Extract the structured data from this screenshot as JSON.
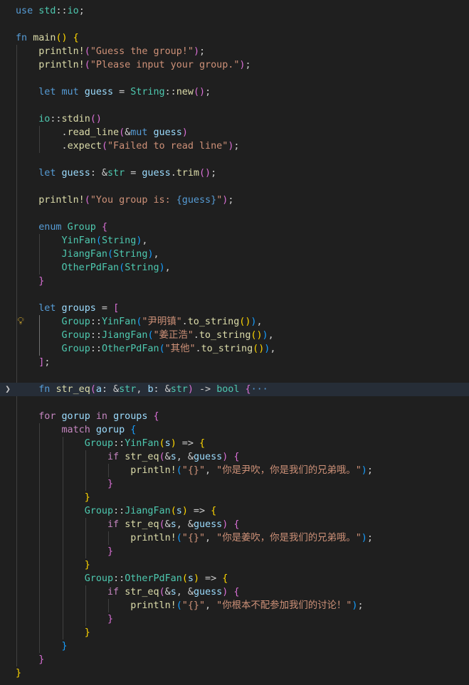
{
  "editor": {
    "theme_colors": {
      "background": "#1f1f1f",
      "keyword": "#569cd6",
      "control": "#c586c0",
      "function": "#dcdcaa",
      "variable": "#9cdcfe",
      "type": "#4ec9b0",
      "string": "#ce9178",
      "bracket_1": "#ffd700",
      "bracket_2": "#da70d6",
      "bracket_3": "#179fff"
    },
    "icons": {
      "fold_chevron": "chevron-right-icon",
      "lightbulb": "lightbulb-icon"
    },
    "lines": [
      [
        [
          "use ",
          "kw"
        ],
        [
          "std",
          "type"
        ],
        [
          "::",
          "punc"
        ],
        [
          "io",
          "type"
        ],
        [
          ";",
          "punc"
        ]
      ],
      [],
      [
        [
          "fn ",
          "kw"
        ],
        [
          "main",
          "fn"
        ],
        [
          "()",
          "b1"
        ],
        [
          " ",
          "punc"
        ],
        [
          "{",
          "b1"
        ]
      ],
      [
        [
          "    println!",
          "fn"
        ],
        [
          "(",
          "b2"
        ],
        [
          "\"Guess the group!\"",
          "str"
        ],
        [
          ")",
          "b2"
        ],
        [
          ";",
          "punc"
        ]
      ],
      [
        [
          "    println!",
          "fn"
        ],
        [
          "(",
          "b2"
        ],
        [
          "\"Please input your group.\"",
          "str"
        ],
        [
          ")",
          "b2"
        ],
        [
          ";",
          "punc"
        ]
      ],
      [],
      [
        [
          "    let ",
          "kw"
        ],
        [
          "mut ",
          "kw"
        ],
        [
          "guess",
          "var"
        ],
        [
          " = ",
          "punc"
        ],
        [
          "String",
          "type"
        ],
        [
          "::",
          "punc"
        ],
        [
          "new",
          "fn"
        ],
        [
          "()",
          "b2"
        ],
        [
          ";",
          "punc"
        ]
      ],
      [],
      [
        [
          "    io",
          "type"
        ],
        [
          "::",
          "punc"
        ],
        [
          "stdin",
          "fn"
        ],
        [
          "()",
          "b2"
        ]
      ],
      [
        [
          "        .",
          "punc"
        ],
        [
          "read_line",
          "fn"
        ],
        [
          "(",
          "b2"
        ],
        [
          "&",
          "punc"
        ],
        [
          "mut ",
          "kw"
        ],
        [
          "guess",
          "var"
        ],
        [
          ")",
          "b2"
        ]
      ],
      [
        [
          "        .",
          "punc"
        ],
        [
          "expect",
          "fn"
        ],
        [
          "(",
          "b2"
        ],
        [
          "\"Failed to read line\"",
          "str"
        ],
        [
          ")",
          "b2"
        ],
        [
          ";",
          "punc"
        ]
      ],
      [],
      [
        [
          "    let ",
          "kw"
        ],
        [
          "guess",
          "var"
        ],
        [
          ": &",
          "punc"
        ],
        [
          "str",
          "type"
        ],
        [
          " = ",
          "punc"
        ],
        [
          "guess",
          "var"
        ],
        [
          ".",
          "punc"
        ],
        [
          "trim",
          "fn"
        ],
        [
          "()",
          "b2"
        ],
        [
          ";",
          "punc"
        ]
      ],
      [],
      [
        [
          "    println!",
          "fn"
        ],
        [
          "(",
          "b2"
        ],
        [
          "\"You group is: ",
          "str"
        ],
        [
          "{guess}",
          "esc"
        ],
        [
          "\"",
          "str"
        ],
        [
          ")",
          "b2"
        ],
        [
          ";",
          "punc"
        ]
      ],
      [],
      [
        [
          "    enum ",
          "kw"
        ],
        [
          "Group",
          "type"
        ],
        [
          " ",
          "punc"
        ],
        [
          "{",
          "b2"
        ]
      ],
      [
        [
          "        YinFan",
          "type"
        ],
        [
          "(",
          "b3"
        ],
        [
          "String",
          "type"
        ],
        [
          ")",
          "b3"
        ],
        [
          ",",
          "punc"
        ]
      ],
      [
        [
          "        JiangFan",
          "type"
        ],
        [
          "(",
          "b3"
        ],
        [
          "String",
          "type"
        ],
        [
          ")",
          "b3"
        ],
        [
          ",",
          "punc"
        ]
      ],
      [
        [
          "        OtherPdFan",
          "type"
        ],
        [
          "(",
          "b3"
        ],
        [
          "String",
          "type"
        ],
        [
          ")",
          "b3"
        ],
        [
          ",",
          "punc"
        ]
      ],
      [
        [
          "    }",
          "b2"
        ]
      ],
      [],
      [
        [
          "    let ",
          "kw"
        ],
        [
          "groups",
          "var"
        ],
        [
          " = ",
          "punc"
        ],
        [
          "[",
          "b2"
        ]
      ],
      [
        [
          "        Group",
          "type"
        ],
        [
          "::",
          "punc"
        ],
        [
          "YinFan",
          "type"
        ],
        [
          "(",
          "b3"
        ],
        [
          "\"尹明镇\"",
          "str"
        ],
        [
          ".",
          "punc"
        ],
        [
          "to_string",
          "fn"
        ],
        [
          "()",
          "b1"
        ],
        [
          ")",
          "b3"
        ],
        [
          ",",
          "punc"
        ]
      ],
      [
        [
          "        Group",
          "type"
        ],
        [
          "::",
          "punc"
        ],
        [
          "JiangFan",
          "type"
        ],
        [
          "(",
          "b3"
        ],
        [
          "\"姜正浩\"",
          "str"
        ],
        [
          ".",
          "punc"
        ],
        [
          "to_string",
          "fn"
        ],
        [
          "()",
          "b1"
        ],
        [
          ")",
          "b3"
        ],
        [
          ",",
          "punc"
        ]
      ],
      [
        [
          "        Group",
          "type"
        ],
        [
          "::",
          "punc"
        ],
        [
          "OtherPdFan",
          "type"
        ],
        [
          "(",
          "b3"
        ],
        [
          "\"其他\"",
          "str"
        ],
        [
          ".",
          "punc"
        ],
        [
          "to_string",
          "fn"
        ],
        [
          "()",
          "b1"
        ],
        [
          ")",
          "b3"
        ],
        [
          ",",
          "punc"
        ]
      ],
      [
        [
          "    ]",
          "b2"
        ],
        [
          ";",
          "punc"
        ]
      ],
      [],
      [
        [
          "    fn ",
          "kw"
        ],
        [
          "str_eq",
          "fn"
        ],
        [
          "(",
          "b2"
        ],
        [
          "a",
          "var"
        ],
        [
          ": &",
          "punc"
        ],
        [
          "str",
          "type"
        ],
        [
          ", ",
          "punc"
        ],
        [
          "b",
          "var"
        ],
        [
          ": &",
          "punc"
        ],
        [
          "str",
          "type"
        ],
        [
          ")",
          "b2"
        ],
        [
          " -> ",
          "punc"
        ],
        [
          "bool",
          "type"
        ],
        [
          " ",
          "punc"
        ],
        [
          "{",
          "b2"
        ],
        [
          "···",
          "fold"
        ]
      ],
      [],
      [
        [
          "    for ",
          "ctl"
        ],
        [
          "gorup",
          "var"
        ],
        [
          " in ",
          "ctl"
        ],
        [
          "groups",
          "var"
        ],
        [
          " ",
          "punc"
        ],
        [
          "{",
          "b2"
        ]
      ],
      [
        [
          "        match ",
          "ctl"
        ],
        [
          "gorup",
          "var"
        ],
        [
          " ",
          "punc"
        ],
        [
          "{",
          "b3"
        ]
      ],
      [
        [
          "            Group",
          "type"
        ],
        [
          "::",
          "punc"
        ],
        [
          "YinFan",
          "type"
        ],
        [
          "(",
          "b1"
        ],
        [
          "s",
          "var"
        ],
        [
          ")",
          "b1"
        ],
        [
          " => ",
          "punc"
        ],
        [
          "{",
          "b1"
        ]
      ],
      [
        [
          "                if ",
          "ctl"
        ],
        [
          "str_eq",
          "fn"
        ],
        [
          "(",
          "b2"
        ],
        [
          "&",
          "punc"
        ],
        [
          "s",
          "var"
        ],
        [
          ", &",
          "punc"
        ],
        [
          "guess",
          "var"
        ],
        [
          ")",
          "b2"
        ],
        [
          " ",
          "punc"
        ],
        [
          "{",
          "b2"
        ]
      ],
      [
        [
          "                    println!",
          "fn"
        ],
        [
          "(",
          "b3"
        ],
        [
          "\"{}\"",
          "str"
        ],
        [
          ", ",
          "punc"
        ],
        [
          "\"你是尹吹，你是我们的兄弟哦。\"",
          "str"
        ],
        [
          ")",
          "b3"
        ],
        [
          ";",
          "punc"
        ]
      ],
      [
        [
          "                }",
          "b2"
        ]
      ],
      [
        [
          "            }",
          "b1"
        ]
      ],
      [
        [
          "            Group",
          "type"
        ],
        [
          "::",
          "punc"
        ],
        [
          "JiangFan",
          "type"
        ],
        [
          "(",
          "b1"
        ],
        [
          "s",
          "var"
        ],
        [
          ")",
          "b1"
        ],
        [
          " => ",
          "punc"
        ],
        [
          "{",
          "b1"
        ]
      ],
      [
        [
          "                if ",
          "ctl"
        ],
        [
          "str_eq",
          "fn"
        ],
        [
          "(",
          "b2"
        ],
        [
          "&",
          "punc"
        ],
        [
          "s",
          "var"
        ],
        [
          ", &",
          "punc"
        ],
        [
          "guess",
          "var"
        ],
        [
          ")",
          "b2"
        ],
        [
          " ",
          "punc"
        ],
        [
          "{",
          "b2"
        ]
      ],
      [
        [
          "                    println!",
          "fn"
        ],
        [
          "(",
          "b3"
        ],
        [
          "\"{}\"",
          "str"
        ],
        [
          ", ",
          "punc"
        ],
        [
          "\"你是姜吹，你是我们的兄弟哦。\"",
          "str"
        ],
        [
          ")",
          "b3"
        ],
        [
          ";",
          "punc"
        ]
      ],
      [
        [
          "                }",
          "b2"
        ]
      ],
      [
        [
          "            }",
          "b1"
        ]
      ],
      [
        [
          "            Group",
          "type"
        ],
        [
          "::",
          "punc"
        ],
        [
          "OtherPdFan",
          "type"
        ],
        [
          "(",
          "b1"
        ],
        [
          "s",
          "var"
        ],
        [
          ")",
          "b1"
        ],
        [
          " => ",
          "punc"
        ],
        [
          "{",
          "b1"
        ]
      ],
      [
        [
          "                if ",
          "ctl"
        ],
        [
          "str_eq",
          "fn"
        ],
        [
          "(",
          "b2"
        ],
        [
          "&",
          "punc"
        ],
        [
          "s",
          "var"
        ],
        [
          ", &",
          "punc"
        ],
        [
          "guess",
          "var"
        ],
        [
          ")",
          "b2"
        ],
        [
          " ",
          "punc"
        ],
        [
          "{",
          "b2"
        ]
      ],
      [
        [
          "                    println!",
          "fn"
        ],
        [
          "(",
          "b3"
        ],
        [
          "\"{}\"",
          "str"
        ],
        [
          ", ",
          "punc"
        ],
        [
          "\"你根本不配参加我们的讨论！\"",
          "str"
        ],
        [
          ")",
          "b3"
        ],
        [
          ";",
          "punc"
        ]
      ],
      [
        [
          "                }",
          "b2"
        ]
      ],
      [
        [
          "            }",
          "b1"
        ]
      ],
      [
        [
          "        }",
          "b3"
        ]
      ],
      [
        [
          "    }",
          "b2"
        ]
      ],
      [
        [
          "}",
          "b1"
        ]
      ]
    ]
  }
}
